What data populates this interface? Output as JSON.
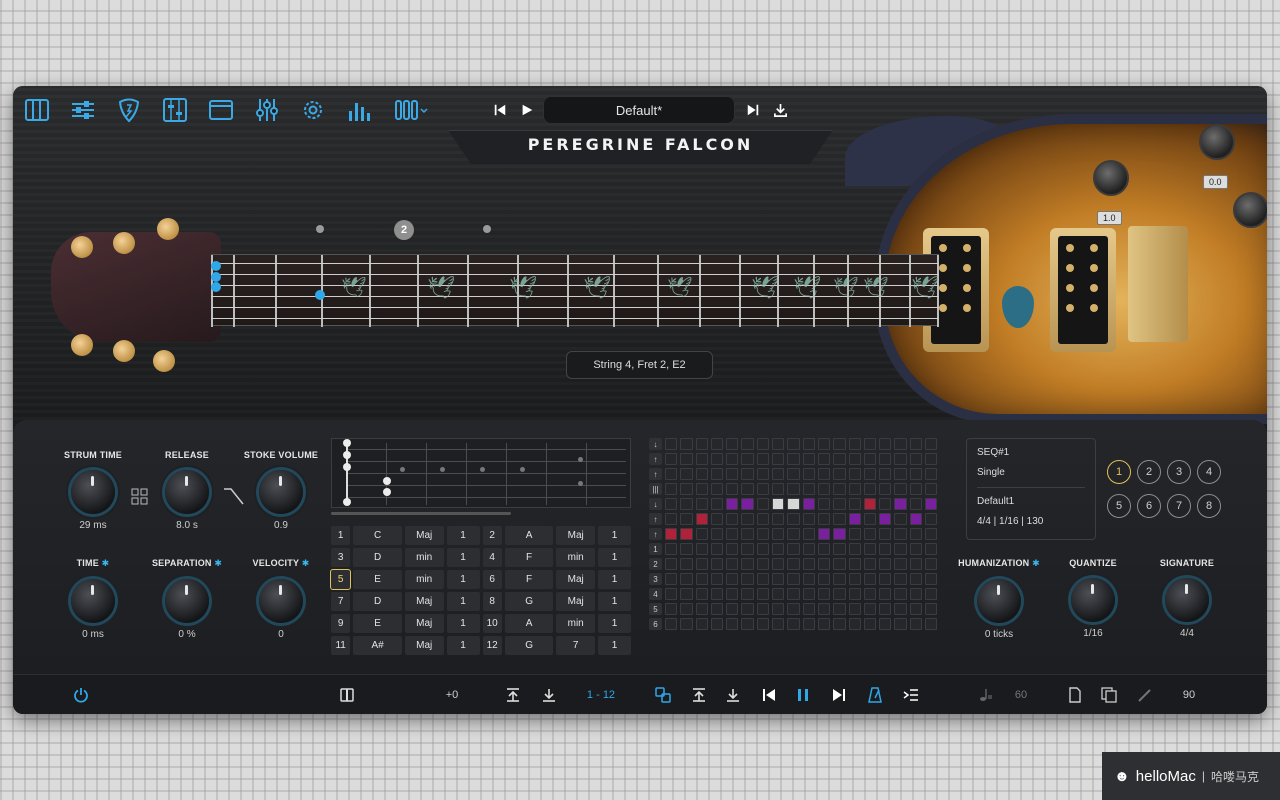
{
  "toolbar": {
    "icons": [
      "keyboard-icon",
      "mixer-icon",
      "pick-icon",
      "eq-icon",
      "window-icon",
      "sliders-icon",
      "gear-icon",
      "bars-icon",
      "strip-icon"
    ],
    "preset_name": "Default*"
  },
  "product": {
    "title": "PEREGRINE FALCON"
  },
  "guitar": {
    "knob_value_1": "0.0",
    "knob_value_2": "1.0",
    "fret_badge": "2",
    "info_text": "String 4, Fret 2, E2"
  },
  "knobs": {
    "strum_time": {
      "label": "STRUM TIME",
      "value": "29 ms"
    },
    "release": {
      "label": "RELEASE",
      "value": "8.0 s"
    },
    "stoke_volume": {
      "label": "STOKE VOLUME",
      "value": "0.9"
    },
    "time": {
      "label": "TIME",
      "value": "0 ms"
    },
    "separation": {
      "label": "SEPARATION",
      "value": "0 %"
    },
    "velocity": {
      "label": "VELOCITY",
      "value": "0"
    },
    "humanization": {
      "label": "HUMANIZATION",
      "value": "0 ticks"
    },
    "quantize": {
      "label": "QUANTIZE",
      "value": "1/16"
    },
    "signature": {
      "label": "SIGNATURE",
      "value": "4/4"
    }
  },
  "chord_table": [
    [
      "1",
      "C",
      "Maj",
      "1",
      "2",
      "A",
      "Maj",
      "1"
    ],
    [
      "3",
      "D",
      "min",
      "1",
      "4",
      "F",
      "min",
      "1"
    ],
    [
      "5",
      "E",
      "min",
      "1",
      "6",
      "F",
      "Maj",
      "1"
    ],
    [
      "7",
      "D",
      "Maj",
      "1",
      "8",
      "G",
      "Maj",
      "1"
    ],
    [
      "9",
      "E",
      "Maj",
      "1",
      "10",
      "A",
      "min",
      "1"
    ],
    [
      "11",
      "A#",
      "Maj",
      "1",
      "12",
      "G",
      "7",
      "1"
    ]
  ],
  "sequencer": {
    "row_labels": [
      "↓",
      "↑",
      "↑",
      "|||",
      "↓",
      "↑",
      "↑",
      "1",
      "2",
      "3",
      "4",
      "5",
      "6"
    ],
    "columns": 18,
    "filled": {
      "4": {
        "4": "purple",
        "5": "purple",
        "7": "white",
        "8": "white",
        "9": "purple",
        "13": "red",
        "15": "purple",
        "17": "purple"
      },
      "5": {
        "2": "red",
        "12": "purple",
        "14": "purple",
        "16": "purple"
      },
      "6": {
        "0": "red",
        "1": "red",
        "10": "purple",
        "11": "purple"
      }
    }
  },
  "seq_info": {
    "name": "SEQ#1",
    "mode": "Single",
    "preset": "Default1",
    "meta": "4/4 | 1/16 | 130"
  },
  "patterns": [
    "1",
    "2",
    "3",
    "4",
    "5",
    "6",
    "7",
    "8"
  ],
  "bottom": {
    "transpose": "+0",
    "range": "1 - 12",
    "tempo_left": "60",
    "tempo_right": "90"
  },
  "watermark": {
    "brand": "helloMac",
    "sep": "|",
    "cn": "哈喽马克"
  }
}
